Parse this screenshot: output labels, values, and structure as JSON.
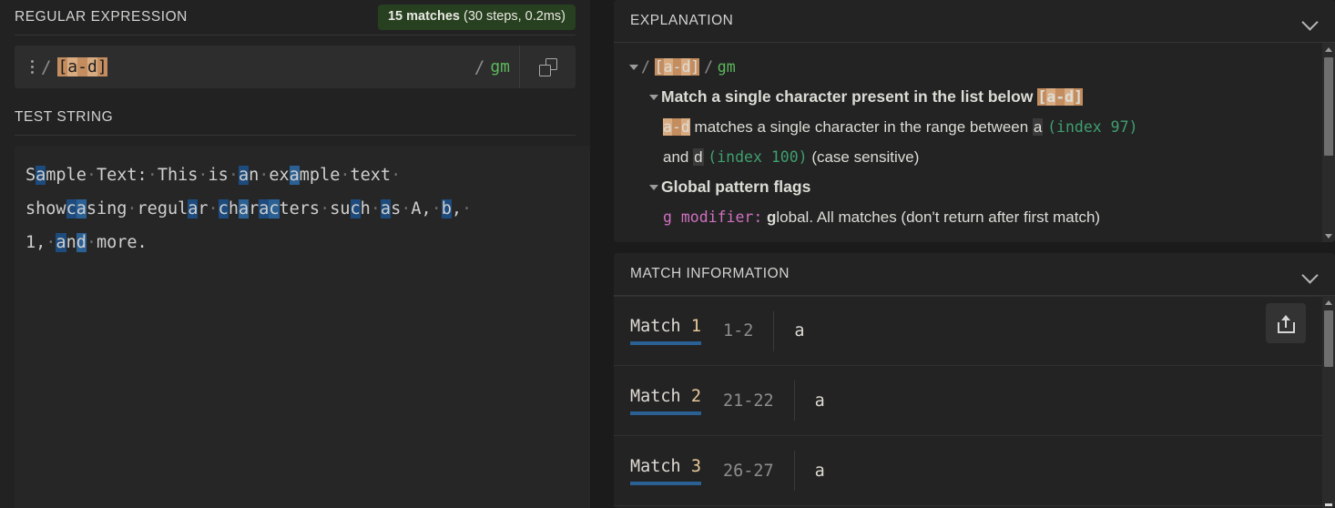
{
  "left": {
    "regex_section_title": "REGULAR EXPRESSION",
    "matches_badge": {
      "count_label": "15 matches",
      "detail": "(30 steps, 0.2ms)",
      "color": "#27401f"
    },
    "regex": {
      "open_delim": "/",
      "close_delim": "/",
      "pattern": "[a-d]",
      "pattern_tokens": [
        {
          "text": "[",
          "shade": "dark"
        },
        {
          "text": "a",
          "shade": "light"
        },
        {
          "text": "-",
          "shade": "dark"
        },
        {
          "text": "d",
          "shade": "light"
        },
        {
          "text": "]",
          "shade": "dark"
        }
      ],
      "flags": "gm",
      "kebab_icon": "more-options-icon",
      "copy_icon": "copy-icon"
    },
    "test_string_title": "TEST STRING",
    "test_string_lines": [
      [
        {
          "t": "S",
          "m": 0
        },
        {
          "t": "a",
          "m": 1
        },
        {
          "t": "mple",
          "m": 0
        },
        {
          "t": "·",
          "m": 0,
          "dot": true
        },
        {
          "t": "Text:",
          "m": 0
        },
        {
          "t": "·",
          "m": 0,
          "dot": true
        },
        {
          "t": "This",
          "m": 0
        },
        {
          "t": "·",
          "m": 0,
          "dot": true
        },
        {
          "t": "is",
          "m": 0
        },
        {
          "t": "·",
          "m": 0,
          "dot": true
        },
        {
          "t": "a",
          "m": 1
        },
        {
          "t": "n",
          "m": 0
        },
        {
          "t": "·",
          "m": 0,
          "dot": true
        },
        {
          "t": "ex",
          "m": 0
        },
        {
          "t": "a",
          "m": 2
        },
        {
          "t": "mple",
          "m": 0
        },
        {
          "t": "·",
          "m": 0,
          "dot": true
        },
        {
          "t": "text",
          "m": 0
        },
        {
          "t": "·",
          "m": 0,
          "dot": true
        }
      ],
      [
        {
          "t": "show",
          "m": 0
        },
        {
          "t": "c",
          "m": 1
        },
        {
          "t": "a",
          "m": 2
        },
        {
          "t": "sing",
          "m": 0
        },
        {
          "t": "·",
          "m": 0,
          "dot": true
        },
        {
          "t": "regul",
          "m": 0
        },
        {
          "t": "a",
          "m": 1
        },
        {
          "t": "r",
          "m": 0
        },
        {
          "t": "·",
          "m": 0,
          "dot": true
        },
        {
          "t": "c",
          "m": 1
        },
        {
          "t": "h",
          "m": 0
        },
        {
          "t": "a",
          "m": 2
        },
        {
          "t": "r",
          "m": 0
        },
        {
          "t": "a",
          "m": 1
        },
        {
          "t": "c",
          "m": 2
        },
        {
          "t": "ters",
          "m": 0
        },
        {
          "t": "·",
          "m": 0,
          "dot": true
        },
        {
          "t": "su",
          "m": 0
        },
        {
          "t": "c",
          "m": 1
        },
        {
          "t": "h",
          "m": 0
        },
        {
          "t": "·",
          "m": 0,
          "dot": true
        },
        {
          "t": "a",
          "m": 1
        },
        {
          "t": "s",
          "m": 0
        },
        {
          "t": "·",
          "m": 0,
          "dot": true
        },
        {
          "t": "A,",
          "m": 0
        },
        {
          "t": "·",
          "m": 0,
          "dot": true
        },
        {
          "t": "b",
          "m": 1
        },
        {
          "t": ",",
          "m": 0
        },
        {
          "t": "·",
          "m": 0,
          "dot": true
        }
      ],
      [
        {
          "t": "1,",
          "m": 0
        },
        {
          "t": "·",
          "m": 0,
          "dot": true
        },
        {
          "t": "a",
          "m": 1
        },
        {
          "t": "n",
          "m": 0
        },
        {
          "t": "d",
          "m": 2
        },
        {
          "t": "·",
          "m": 0,
          "dot": true
        },
        {
          "t": "more.",
          "m": 0
        }
      ]
    ]
  },
  "explanation": {
    "title": "EXPLANATION",
    "collapse_icon": "chevron-down-icon",
    "root": {
      "open_delim": "/",
      "pattern": "[a-d]",
      "close_delim": "/",
      "flags": "gm"
    },
    "node_match": {
      "heading": "Match a single character present in the list below",
      "chip": "[a-d]",
      "detail_chip": "a-d",
      "detail_1": " matches a single character in the range between ",
      "detail_a": "a",
      "detail_index_a": "(index 97)",
      "detail_and": " and ",
      "detail_d": "d",
      "detail_index_d": "(index 100)",
      "detail_case": "(case sensitive)"
    },
    "node_flags": {
      "heading": "Global pattern flags",
      "modifier": "g modifier:",
      "modifier_bold": "g",
      "modifier_rest": "lobal. All matches (don't return after first match)"
    }
  },
  "match_info": {
    "title": "MATCH INFORMATION",
    "collapse_icon": "chevron-down-icon",
    "share_icon": "share-export-icon",
    "rows": [
      {
        "label_word": "Match",
        "label_num": "1",
        "range": "1-2",
        "value": "a"
      },
      {
        "label_word": "Match",
        "label_num": "2",
        "range": "21-22",
        "value": "a"
      },
      {
        "label_word": "Match",
        "label_num": "3",
        "range": "26-27",
        "value": "a"
      }
    ]
  }
}
